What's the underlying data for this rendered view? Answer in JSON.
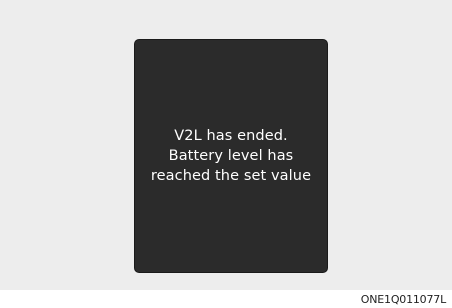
{
  "popup": {
    "message_lines": [
      "V2L has ended.",
      "Battery level has",
      "reached the set value"
    ]
  },
  "figure_code": "ONE1Q011077L",
  "colors": {
    "screen_background": "#ededed",
    "popup_background": "#2b2b2b",
    "popup_text": "#ffffff"
  }
}
